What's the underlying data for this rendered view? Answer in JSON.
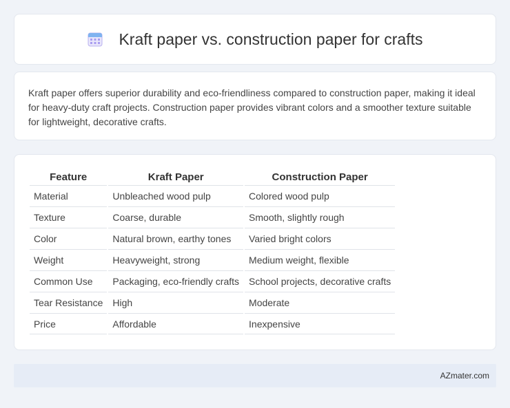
{
  "header": {
    "title": "Kraft paper vs. construction paper for crafts",
    "icon": "calendar-icon"
  },
  "summary": {
    "text": "Kraft paper offers superior durability and eco-friendliness compared to construction paper, making it ideal for heavy-duty craft projects. Construction paper provides vibrant colors and a smoother texture suitable for lightweight, decorative crafts."
  },
  "table": {
    "headers": [
      "Feature",
      "Kraft Paper",
      "Construction Paper"
    ],
    "rows": [
      [
        "Material",
        "Unbleached wood pulp",
        "Colored wood pulp"
      ],
      [
        "Texture",
        "Coarse, durable",
        "Smooth, slightly rough"
      ],
      [
        "Color",
        "Natural brown, earthy tones",
        "Varied bright colors"
      ],
      [
        "Weight",
        "Heavyweight, strong",
        "Medium weight, flexible"
      ],
      [
        "Common Use",
        "Packaging, eco-friendly crafts",
        "School projects, decorative crafts"
      ],
      [
        "Tear Resistance",
        "High",
        "Moderate"
      ],
      [
        "Price",
        "Affordable",
        "Inexpensive"
      ]
    ]
  },
  "footer": {
    "site": "AZmater.com"
  },
  "colors": {
    "background": "#f0f3f8",
    "card": "#ffffff",
    "footer_bg": "#e6ecf6",
    "icon_accent": "#7b6fe0"
  }
}
